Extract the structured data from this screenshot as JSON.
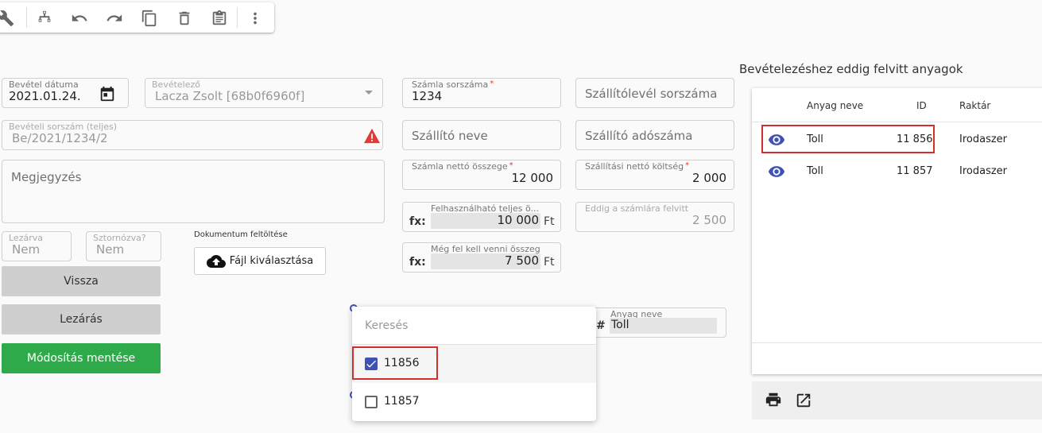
{
  "toolbar": {
    "icons": [
      "wrench-icon",
      "sitemap-icon",
      "undo-icon",
      "redo-icon",
      "copy-icon",
      "delete-icon",
      "clipboard-icon",
      "more-vert-icon"
    ]
  },
  "form": {
    "bevetel_datuma": {
      "label": "Bevétel dátuma",
      "value": "2021.01.24."
    },
    "bevetelezo": {
      "label": "Bevételező",
      "value": "Lacza Zsolt [68b0f6960f]"
    },
    "bevetel_sorszam": {
      "label": "Bevételi sorszám (teljes)",
      "value": "Be/2021/1234/2"
    },
    "megjegyzes": {
      "placeholder": "Megjegyzés"
    },
    "lezarva": {
      "label": "Lezárva",
      "value": "Nem"
    },
    "sztornozva": {
      "label": "Sztornózva?",
      "value": "Nem"
    },
    "dokumentum": {
      "label": "Dokumentum feltöltése",
      "button": "Fájl kiválasztása"
    },
    "szamla_sorszam": {
      "label": "Számla sorszáma",
      "required": "*",
      "value": "1234"
    },
    "szallitolevel": {
      "placeholder": "Szállítólevél sorszáma"
    },
    "szallito_neve": {
      "placeholder": "Szállító neve"
    },
    "szallito_adoszama": {
      "placeholder": "Szállító adószáma"
    },
    "szamla_netto": {
      "label": "Számla nettó összege",
      "required": "*",
      "value": "12 000"
    },
    "szallitasi_netto": {
      "label": "Szállítási nettó költség",
      "required": "*",
      "value": "2 000"
    },
    "felhasznalhato": {
      "label": "Felhasználható teljes ö...",
      "fx": "fx:",
      "value": "10 000",
      "unit": "Ft"
    },
    "eddig_felvitt": {
      "label": "Eddig a számlára felvitt",
      "value": "2 500"
    },
    "meg_fel_kell": {
      "label": "Még fel kell venni összeg",
      "fx": "fx:",
      "value": "7 500",
      "unit": "Ft"
    },
    "anyag_neve": {
      "label": "Anyag neve",
      "hash": "#",
      "value": "Toll"
    }
  },
  "buttons": {
    "vissza": "Vissza",
    "lezaras": "Lezárás",
    "mentes": "Módosítás mentése"
  },
  "dropdown": {
    "search_placeholder": "Keresés",
    "options": [
      {
        "label": "11856",
        "checked": true
      },
      {
        "label": "11857",
        "checked": false
      }
    ]
  },
  "panel": {
    "title": "Bevételezéshez eddig felvitt anyagok",
    "columns": {
      "name": "Anyag neve",
      "id": "ID",
      "warehouse": "Raktár"
    },
    "rows": [
      {
        "name": "Toll",
        "id": "11 856",
        "warehouse": "Irodaszer"
      },
      {
        "name": "Toll",
        "id": "11 857",
        "warehouse": "Irodaszer"
      }
    ]
  },
  "colors": {
    "accent": "#3f51b5",
    "save_green": "#2eaa4b",
    "highlight_red": "#d32f2f",
    "warning_red": "#e53935"
  }
}
